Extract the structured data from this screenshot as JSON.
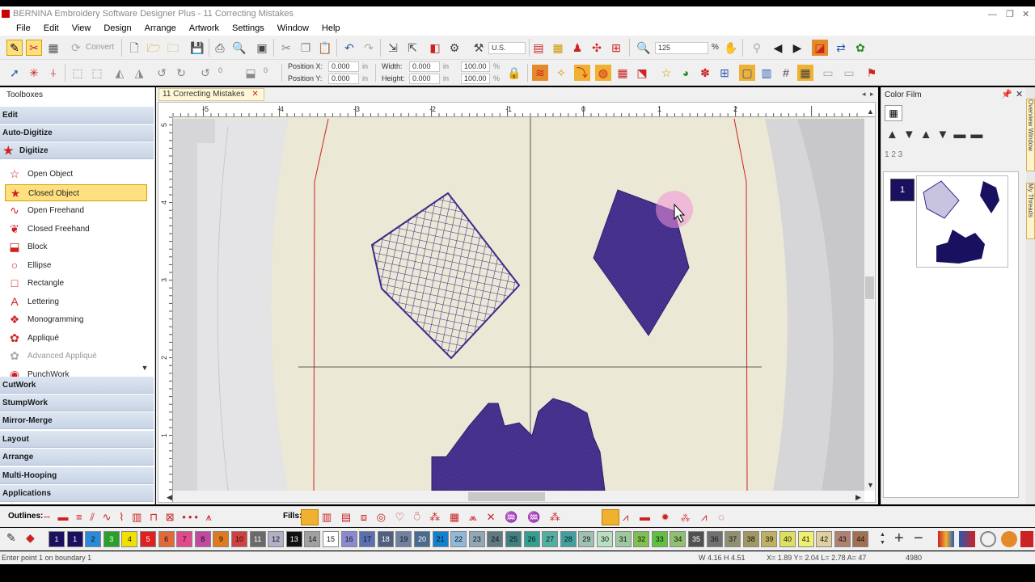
{
  "window": {
    "title": "BERNINA Embroidery Software Designer Plus - 11 Correcting Mistakes"
  },
  "menu": [
    "File",
    "Edit",
    "View",
    "Design",
    "Arrange",
    "Artwork",
    "Settings",
    "Window",
    "Help"
  ],
  "toolbar": {
    "convert_label": "Convert",
    "units": "U.S.",
    "zoom": "125",
    "zoom_unit": "%",
    "position_x_label": "Position X:",
    "position_y_label": "Position Y:",
    "position_x": "0.000",
    "position_y": "0.000",
    "pos_unit": "in",
    "width_label": "Width:",
    "height_label": "Height:",
    "width": "0.000",
    "height": "0.000",
    "size_unit": "in",
    "scale_w": "100.00",
    "scale_h": "100.00",
    "scale_unit": "%",
    "rotate_value": "0",
    "skew_value": "0"
  },
  "toolboxes": {
    "title": "Toolboxes",
    "headers": [
      "Edit",
      "Auto-Digitize",
      "Digitize"
    ],
    "digitize_tools": [
      {
        "label": "Open Object",
        "icon": "open-object-icon"
      },
      {
        "label": "Closed Object",
        "icon": "closed-object-icon",
        "selected": true
      },
      {
        "label": "Open Freehand",
        "icon": "open-freehand-icon"
      },
      {
        "label": "Closed Freehand",
        "icon": "closed-freehand-icon"
      },
      {
        "label": "Block",
        "icon": "block-icon"
      },
      {
        "label": "Ellipse",
        "icon": "ellipse-icon"
      },
      {
        "label": "Rectangle",
        "icon": "rectangle-icon"
      },
      {
        "label": "Lettering",
        "icon": "lettering-icon"
      },
      {
        "label": "Monogramming",
        "icon": "monogramming-icon"
      },
      {
        "label": "Appliqué",
        "icon": "applique-icon"
      },
      {
        "label": "Advanced Appliqué",
        "icon": "advanced-applique-icon",
        "disabled": true
      },
      {
        "label": "PunchWork",
        "icon": "punchwork-icon"
      }
    ],
    "footer_headers": [
      "CutWork",
      "StumpWork",
      "Mirror-Merge",
      "Layout",
      "Arrange",
      "Multi-Hooping",
      "Applications"
    ]
  },
  "document": {
    "tab_label": "11 Correcting Mistakes",
    "ruler_h": [
      "-5",
      "-4",
      "-3",
      "-2",
      "-1",
      "0",
      "1",
      "2"
    ],
    "ruler_v": [
      "5",
      "4",
      "3",
      "2",
      "1"
    ]
  },
  "color_film": {
    "title": "Color Film",
    "item_number": "1",
    "order_labels": "1 2 3"
  },
  "side_tabs": [
    "Overview Window",
    "My Threads"
  ],
  "bottom_bar": {
    "outlines_label": "Outlines:",
    "fills_label": "Fills:"
  },
  "palette": {
    "swatches": [
      {
        "n": "1",
        "c": "#1a1060"
      },
      {
        "n": "1",
        "c": "#1a1060"
      },
      {
        "n": "2",
        "c": "#2a8ad8"
      },
      {
        "n": "3",
        "c": "#2aa02a"
      },
      {
        "n": "4",
        "c": "#f0e000"
      },
      {
        "n": "5",
        "c": "#e02020"
      },
      {
        "n": "6",
        "c": "#e06a3a"
      },
      {
        "n": "7",
        "c": "#e04a8a"
      },
      {
        "n": "8",
        "c": "#c04aa0"
      },
      {
        "n": "9",
        "c": "#e07a20"
      },
      {
        "n": "10",
        "c": "#d04040"
      },
      {
        "n": "11",
        "c": "#6a6a6a"
      },
      {
        "n": "12",
        "c": "#b0b0c8"
      },
      {
        "n": "13",
        "c": "#101010"
      },
      {
        "n": "14",
        "c": "#a0a0a0"
      },
      {
        "n": "15",
        "c": "#ffffff"
      },
      {
        "n": "16",
        "c": "#8a8ad0"
      },
      {
        "n": "17",
        "c": "#5a70b0"
      },
      {
        "n": "18",
        "c": "#506080"
      },
      {
        "n": "19",
        "c": "#7080a0"
      },
      {
        "n": "20",
        "c": "#4a6a90"
      },
      {
        "n": "21",
        "c": "#1080d0"
      },
      {
        "n": "22",
        "c": "#90b8d8"
      },
      {
        "n": "23",
        "c": "#90a8b8"
      },
      {
        "n": "24",
        "c": "#607880"
      },
      {
        "n": "25",
        "c": "#408080"
      },
      {
        "n": "26",
        "c": "#30a090"
      },
      {
        "n": "27",
        "c": "#50b0a0"
      },
      {
        "n": "28",
        "c": "#40a0a0"
      },
      {
        "n": "29",
        "c": "#a0c0b0"
      },
      {
        "n": "30",
        "c": "#b8e0c0"
      },
      {
        "n": "31",
        "c": "#a0c8a0"
      },
      {
        "n": "32",
        "c": "#80c050"
      },
      {
        "n": "33",
        "c": "#60c040"
      },
      {
        "n": "34",
        "c": "#90c070"
      },
      {
        "n": "35",
        "c": "#505050"
      },
      {
        "n": "36",
        "c": "#707070"
      },
      {
        "n": "37",
        "c": "#909070"
      },
      {
        "n": "38",
        "c": "#a09860"
      },
      {
        "n": "39",
        "c": "#c0b060"
      },
      {
        "n": "40",
        "c": "#e0e060"
      },
      {
        "n": "41",
        "c": "#f0f070"
      },
      {
        "n": "42",
        "c": "#e0d0a0"
      },
      {
        "n": "43",
        "c": "#b08070"
      },
      {
        "n": "44",
        "c": "#a07050"
      }
    ]
  },
  "status": {
    "prompt": "Enter point 1 on boundary 1",
    "size": "W 4.16 H 4.51",
    "coords": "X= 1.89 Y= 2.04 L= 2.78 A= 47",
    "stitches": "4980"
  },
  "colors": {
    "thread": "#3d2a8a",
    "fabric": "#ebe8d5",
    "hoop_line": "#cc2222",
    "selected": "#ffe080"
  }
}
